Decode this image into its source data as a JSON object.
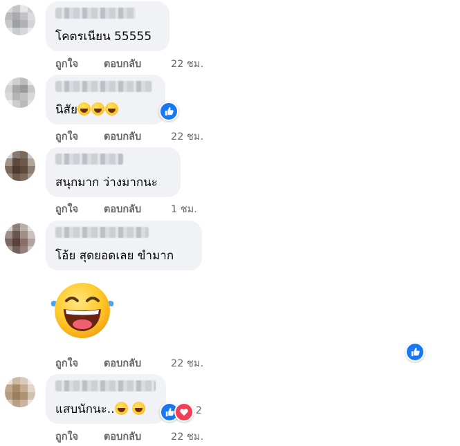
{
  "actions": {
    "like": "ถูกใจ",
    "reply": "ตอบกลับ"
  },
  "colors": {
    "bubble": "#f0f2f5",
    "action_text": "#65676b",
    "like_blue": "#1877f2",
    "heart_red": "#f33e58"
  },
  "comments": [
    {
      "text": "โคตรเนียน 55555",
      "time": "22 ชม."
    },
    {
      "text": "นิสัย",
      "time": "22 ชม.",
      "reaction": "like-icon"
    },
    {
      "text": "สนุกมาก ว่างมากนะ",
      "time": "1 ชม."
    },
    {
      "text": "โอ้ย สุดยอดเลย ขำมาก",
      "time": "22 ชม.",
      "sticker": "laughing-emoji-sticker",
      "reaction": "like-icon"
    },
    {
      "text": "แสบนักนะ..",
      "time": "22 ชม.",
      "reactions": [
        "like-icon",
        "heart-icon"
      ],
      "reaction_count": "2"
    }
  ]
}
